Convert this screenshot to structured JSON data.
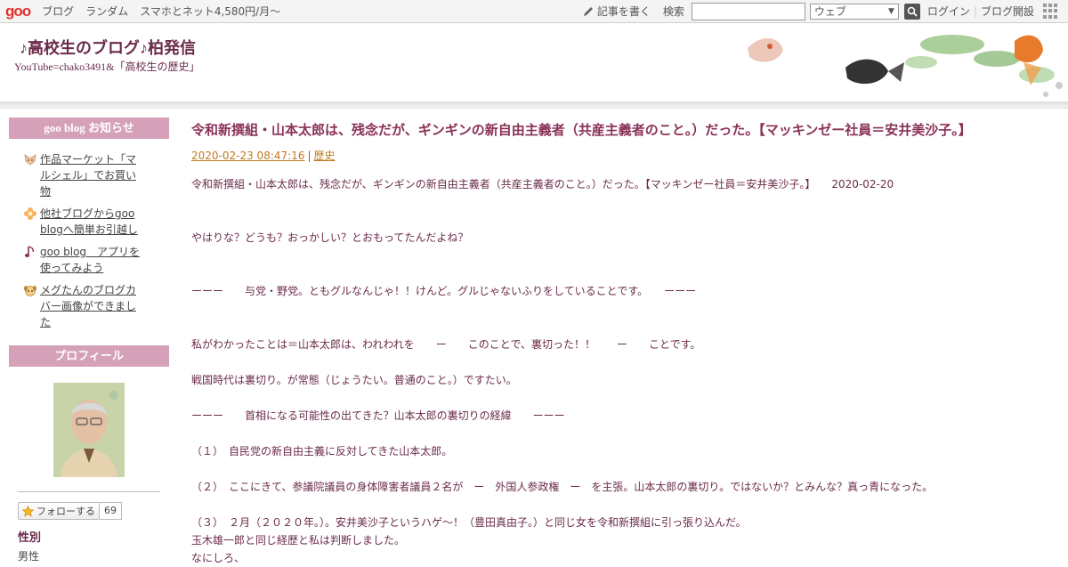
{
  "topbar": {
    "logo": "goo",
    "links": [
      "ブログ",
      "ランダム",
      "スマホとネット4,580円/月～"
    ],
    "write_label": "記事を書く",
    "search_label": "検索",
    "search_value": "",
    "search_scope": "ウェブ",
    "login_label": "ログイン",
    "blog_open_label": "ブログ開設"
  },
  "header": {
    "title": "♪高校生のブログ♪柏発信",
    "description": "YouTube=chako3491&「高校生の歴史」"
  },
  "sidebar": {
    "notice_heading": "goo blog お知らせ",
    "notices": [
      {
        "icon": "fox-icon",
        "lines": [
          "作品マーケット「マ",
          "ルシェル」でお買い",
          "物"
        ]
      },
      {
        "icon": "flower-icon",
        "lines": [
          "他社ブログからgoo",
          "blogへ簡単お引越し"
        ]
      },
      {
        "icon": "music-note-icon",
        "lines": [
          "goo blog　アプリを",
          "使ってみよう"
        ]
      },
      {
        "icon": "dog-icon",
        "lines": [
          "メグたんのブログカ",
          "バー画像ができまし",
          "た"
        ]
      }
    ],
    "profile_heading": "プロフィール",
    "follow_label": "フォローする",
    "follow_count": "69",
    "gender_label": "性別",
    "gender_value": "男性"
  },
  "entry": {
    "title": "令和新撰組・山本太郎は、残念だが、ギンギンの新自由主義者（共産主義者のこと。）だった。【マッキンゼー社員＝安井美沙子。】",
    "datetime": "2020-02-23 08:47:16",
    "category": "歴史",
    "paragraphs": [
      "令和新撰組・山本太郎は、残念だが、ギンギンの新自由主義者（共産主義者のこと。）だった。【マッキンゼー社員＝安井美沙子。】　　2020-02-20",
      "",
      "",
      "やはりな？どうも？おっかしい？とおもってたんだよね？",
      "",
      "",
      "ーーー　　与党・野党。ともグルなんじゃ！！けんど。グルじゃないふりをしていることです。　　ーーー",
      "",
      "",
      "私がわかったことは＝山本太郎は、われわれを　　ー　　このことで、裏切った！！　　ー　　ことです。",
      "",
      "戦国時代は裏切り。が常態（じょうたい。普通のこと。）ですたい。",
      "",
      "ーーー　　首相になる可能性の出てきた？山本太郎の裏切りの経緯　　ーーー",
      "",
      "（１）　自民党の新自由主義に反対してきた山本太郎。",
      "",
      "（２）　ここにきて、参議院議員の身体障害者議員２名が　ー　外国人参政権　ー　を主張。山本太郎の裏切り。ではないか？とみんな？真っ青になった。",
      "",
      "（３）　２月（２０２０年。）。安井美沙子というハゲ〜！（豊田真由子。）と同じ女を令和新撰組に引っ張り込んだ。",
      "玉木雄一郎と同じ経歴と私は判断しました。",
      "なにしろ、"
    ]
  }
}
